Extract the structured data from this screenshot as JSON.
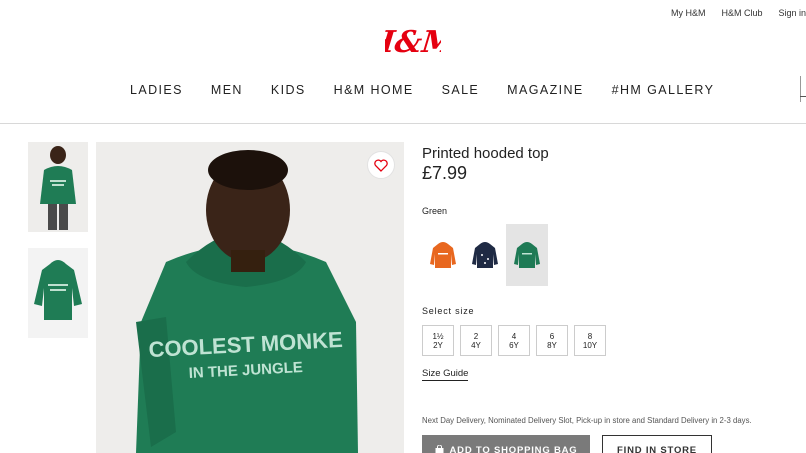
{
  "header": {
    "util_links": [
      "My H&M",
      "H&M Club",
      "Sign in"
    ],
    "logo_text": "H&M",
    "brand_color": "#e50010"
  },
  "nav": {
    "items": [
      "LADIES",
      "MEN",
      "KIDS",
      "H&M HOME",
      "SALE",
      "MAGAZINE",
      "#HM GALLERY"
    ]
  },
  "product": {
    "title": "Printed hooded top",
    "price": "£7.99",
    "color_label": "Green",
    "print_text_line1": "COOLEST MONKE",
    "print_text_line2": "IN THE JUNGLE",
    "swatches": [
      {
        "color": "#e8671f",
        "selected": false
      },
      {
        "color": "#1f2a44",
        "selected": false
      },
      {
        "color": "#1e7a55",
        "selected": true
      }
    ],
    "size_label": "Select size",
    "sizes": [
      {
        "top": "1½",
        "bottom": "2Y"
      },
      {
        "top": "2",
        "bottom": "4Y"
      },
      {
        "top": "4",
        "bottom": "6Y"
      },
      {
        "top": "6",
        "bottom": "8Y"
      },
      {
        "top": "8",
        "bottom": "10Y"
      }
    ],
    "size_guide": "Size Guide",
    "delivery": "Next Day Delivery, Nominated Delivery Slot, Pick-up in store and Standard Delivery in 2-3 days.",
    "add_to_bag": "ADD TO SHOPPING BAG",
    "find_in_store": "FIND IN STORE",
    "hoodie_color": "#1f7c55"
  }
}
